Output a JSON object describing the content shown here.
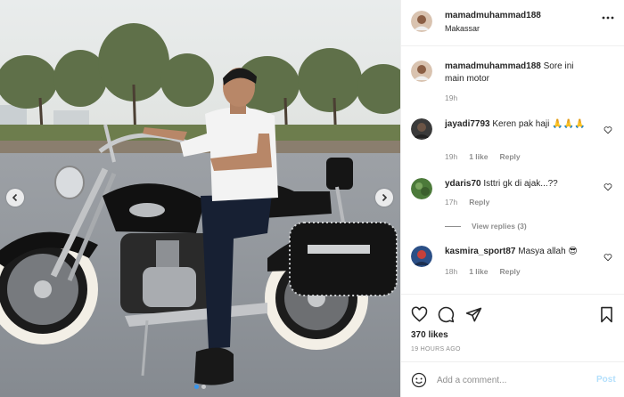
{
  "post": {
    "username": "mamadmuhammad188",
    "location": "Makassar",
    "caption_username": "mamadmuhammad188",
    "caption_text": "Sore ini main motor",
    "caption_time": "19h",
    "likes": "370 likes",
    "time_ago": "19 HOURS AGO"
  },
  "comments": [
    {
      "username": "jayadi7793",
      "text": "Keren pak haji",
      "emoji": "🙏🙏🙏",
      "time": "19h",
      "likes": "1 like",
      "reply": "Reply"
    },
    {
      "username": "ydaris70",
      "text": "Isttri gk di ajak...??",
      "emoji": "",
      "time": "17h",
      "likes": "",
      "reply": "Reply",
      "view_replies": "View replies (3)"
    },
    {
      "username": "kasmira_sport87",
      "text": "Masya allah",
      "emoji": "😎",
      "time": "18h",
      "likes": "1 like",
      "reply": "Reply"
    }
  ],
  "add_comment": {
    "placeholder": "Add a comment...",
    "post_label": "Post"
  },
  "carousel": {
    "dots": 2,
    "active_index": 0
  },
  "colors": {
    "link_blue": "#3897f0",
    "post_disabled": "#b2dffc",
    "muted": "#8e8e8e",
    "text": "#262626",
    "border": "#efefef"
  },
  "icons": [
    "more-icon",
    "heart-icon",
    "comment-icon",
    "share-icon",
    "bookmark-icon",
    "emoji-icon",
    "chevron-left-icon",
    "chevron-right-icon"
  ]
}
